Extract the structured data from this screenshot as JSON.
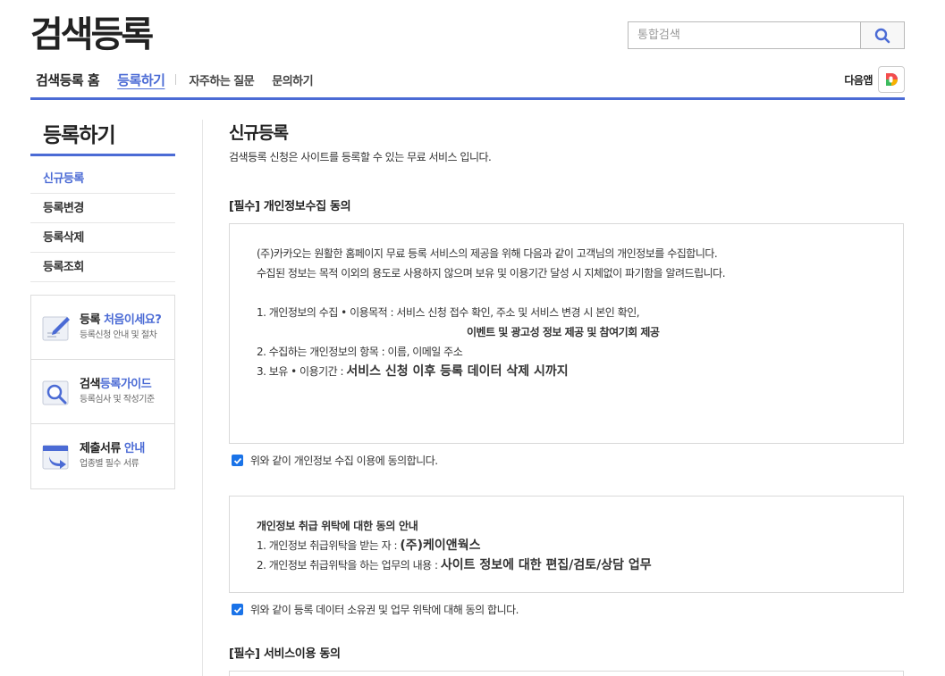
{
  "header": {
    "logo": "검색등록",
    "search_placeholder": "통합검색",
    "daum_app_label": "다음앱"
  },
  "gnb": [
    {
      "label": "검색등록 홈"
    },
    {
      "label": "등록하기"
    },
    {
      "label": "자주하는 질문"
    },
    {
      "label": "문의하기"
    }
  ],
  "sidebar": {
    "title": "등록하기",
    "items": [
      {
        "label": "신규등록"
      },
      {
        "label": "등록변경"
      },
      {
        "label": "등록삭제"
      },
      {
        "label": "등록조회"
      }
    ],
    "guides": [
      {
        "title_a": "등록 ",
        "title_b": "처음이세요?",
        "sub": "등록신청 안내 및 절차"
      },
      {
        "title_a": "검색",
        "title_b": "등록가이드",
        "sub": "등록심사 및 작성기준"
      },
      {
        "title_a": "제출서류 ",
        "title_b": "안내",
        "sub": "업종별 필수 서류"
      }
    ]
  },
  "content": {
    "title": "신규등록",
    "desc": "검색등록 신청은 사이트를 등록할 수 있는 무료 서비스 입니다.",
    "section1_title": "[필수] 개인정보수집 동의",
    "privacy": {
      "line1": "(주)카카오는 원활한 홈페이지 무료 등록 서비스의 제공을 위해 다음과 같이 고객님의 개인정보를 수집합니다.",
      "line2": "수집된 정보는 목적 이외의 용도로 사용하지 않으며 보유 및 이용기간 달성 시 지체없이 파기함을 알려드립니다.",
      "item1": "1. 개인정보의 수집 • 이용목적 : 서비스 신청 접수 확인, 주소 및 서비스 변경 시 본인 확인,",
      "item1_cont": "이벤트 및 광고성 정보 제공 및 참여기회 제공",
      "item2": "2. 수집하는 개인정보의 항목 : 이름, 이메일 주소",
      "item3_a": "3. 보유 • 이용기간 : ",
      "item3_b": "서비스 신청 이후 등록 데이터 삭제 시까지"
    },
    "agree1": "위와 같이 개인정보 수집 이용에 동의합니다.",
    "consign": {
      "title": "개인정보 취급 위탁에 대한 동의 안내",
      "item1_a": "1. 개인정보 취급위탁을 받는 자 : ",
      "item1_b": "(주)케이앤웍스",
      "item2_a": "2. 개인정보 취급위탁을 하는 업무의 내용 : ",
      "item2_b": "사이트 정보에 대한 편집/검토/상담 업무"
    },
    "agree2": "위와 같이 등록 데이터 소유권 및 업무 위탁에 대해 동의 합니다.",
    "section3_title": "[필수] 서비스이용 동의"
  },
  "colors": {
    "accent": "#4b6bd5",
    "checkbox": "#1a73e8"
  }
}
